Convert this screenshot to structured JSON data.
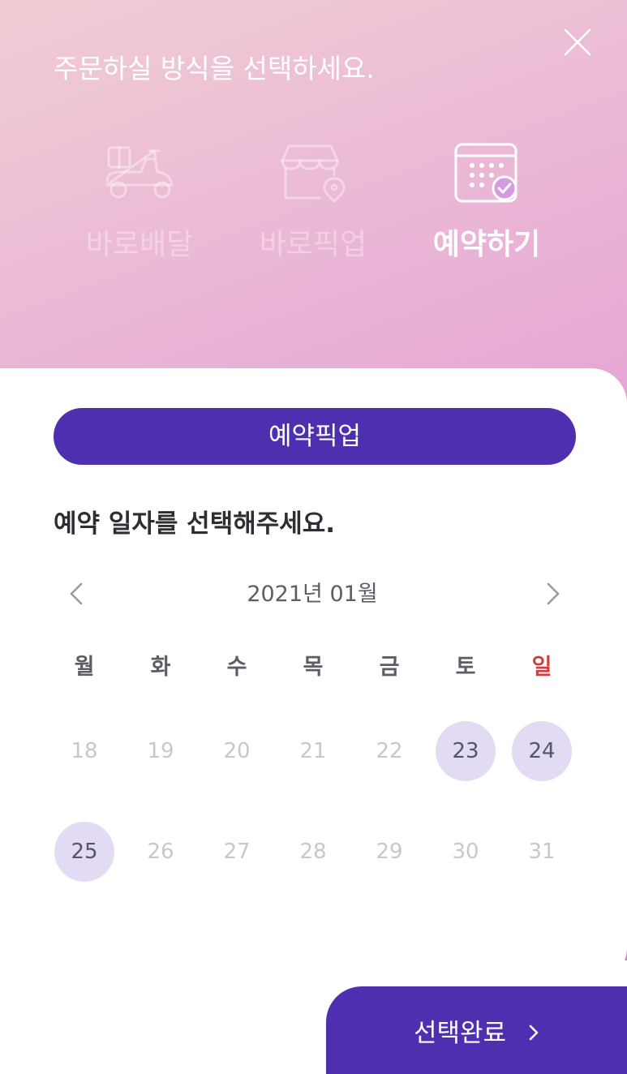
{
  "header": {
    "title": "주문하실 방식을 선택하세요."
  },
  "mode_tabs": [
    {
      "label": "바로배달",
      "icon": "scooter-icon",
      "selected": false
    },
    {
      "label": "바로픽업",
      "icon": "store-location-icon",
      "selected": false
    },
    {
      "label": "예약하기",
      "icon": "calendar-check-icon",
      "selected": true
    }
  ],
  "reservation": {
    "pickup_label": "예약픽업",
    "section_title": "예약 일자를 선택해주세요."
  },
  "calendar": {
    "month_label": "2021년 01월",
    "weekdays": [
      "월",
      "화",
      "수",
      "목",
      "금",
      "토",
      "일"
    ],
    "weeks": [
      [
        {
          "day": "18",
          "available": false
        },
        {
          "day": "19",
          "available": false
        },
        {
          "day": "20",
          "available": false
        },
        {
          "day": "21",
          "available": false
        },
        {
          "day": "22",
          "available": false
        },
        {
          "day": "23",
          "available": true
        },
        {
          "day": "24",
          "available": true
        }
      ],
      [
        {
          "day": "25",
          "available": true
        },
        {
          "day": "26",
          "available": false
        },
        {
          "day": "27",
          "available": false
        },
        {
          "day": "28",
          "available": false
        },
        {
          "day": "29",
          "available": false
        },
        {
          "day": "30",
          "available": false
        },
        {
          "day": "31",
          "available": false
        }
      ]
    ]
  },
  "footer": {
    "confirm_label": "선택완료"
  },
  "colors": {
    "accent": "#4e2fb0",
    "available_day": "#e2dbf3",
    "sunday": "#d23c3c",
    "disabled_day": "#c8c8cc"
  }
}
